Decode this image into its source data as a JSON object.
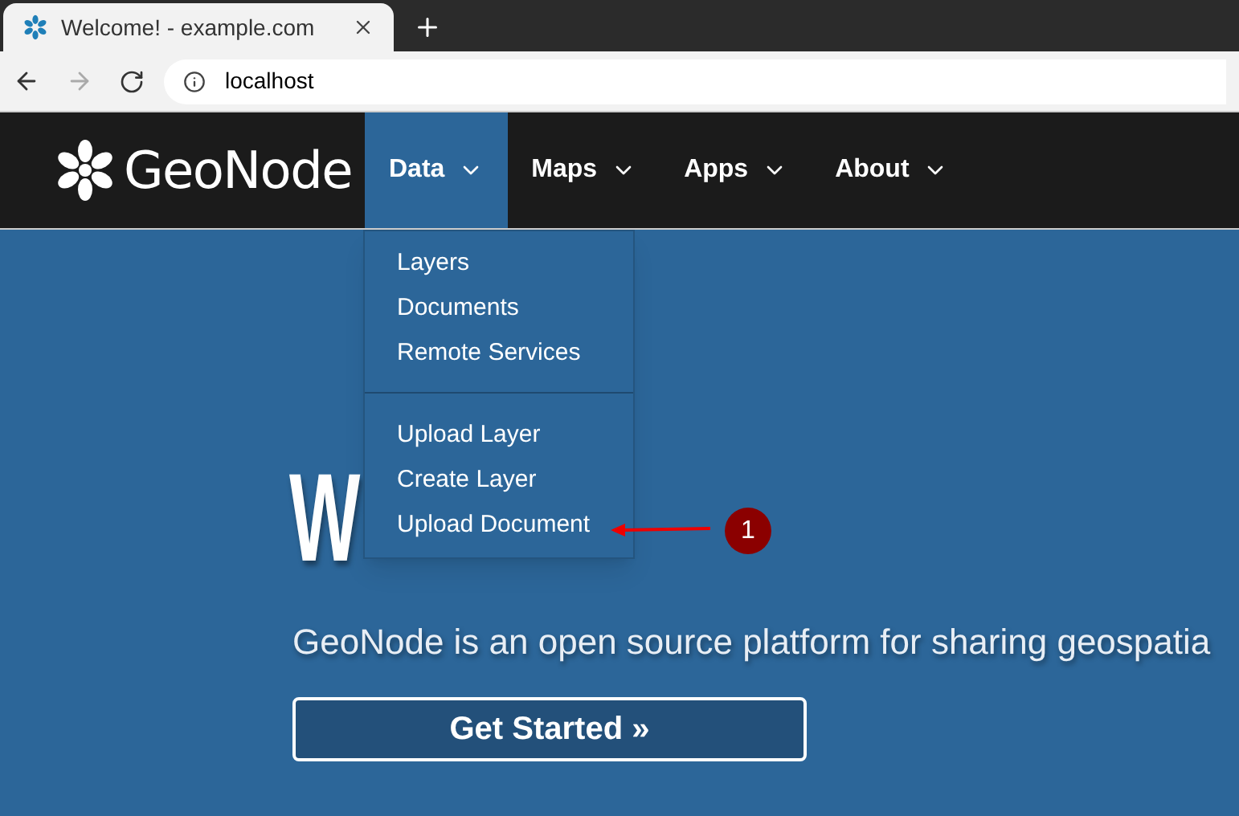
{
  "browser": {
    "tab_title": "Welcome! - example.com",
    "url": "localhost"
  },
  "navbar": {
    "brand": "GeoNode",
    "items": [
      {
        "label": "Data",
        "selected": true
      },
      {
        "label": "Maps",
        "selected": false
      },
      {
        "label": "Apps",
        "selected": false
      },
      {
        "label": "About",
        "selected": false
      }
    ]
  },
  "dropdown": {
    "groups": [
      [
        "Layers",
        "Documents",
        "Remote Services"
      ],
      [
        "Upload Layer",
        "Create Layer",
        "Upload Document"
      ]
    ]
  },
  "hero": {
    "heading_parts": [
      "W"
    ],
    "text": "GeoNode is an open source platform for sharing geospatia",
    "button": "Get Started »"
  },
  "annotation": {
    "label": "1"
  }
}
